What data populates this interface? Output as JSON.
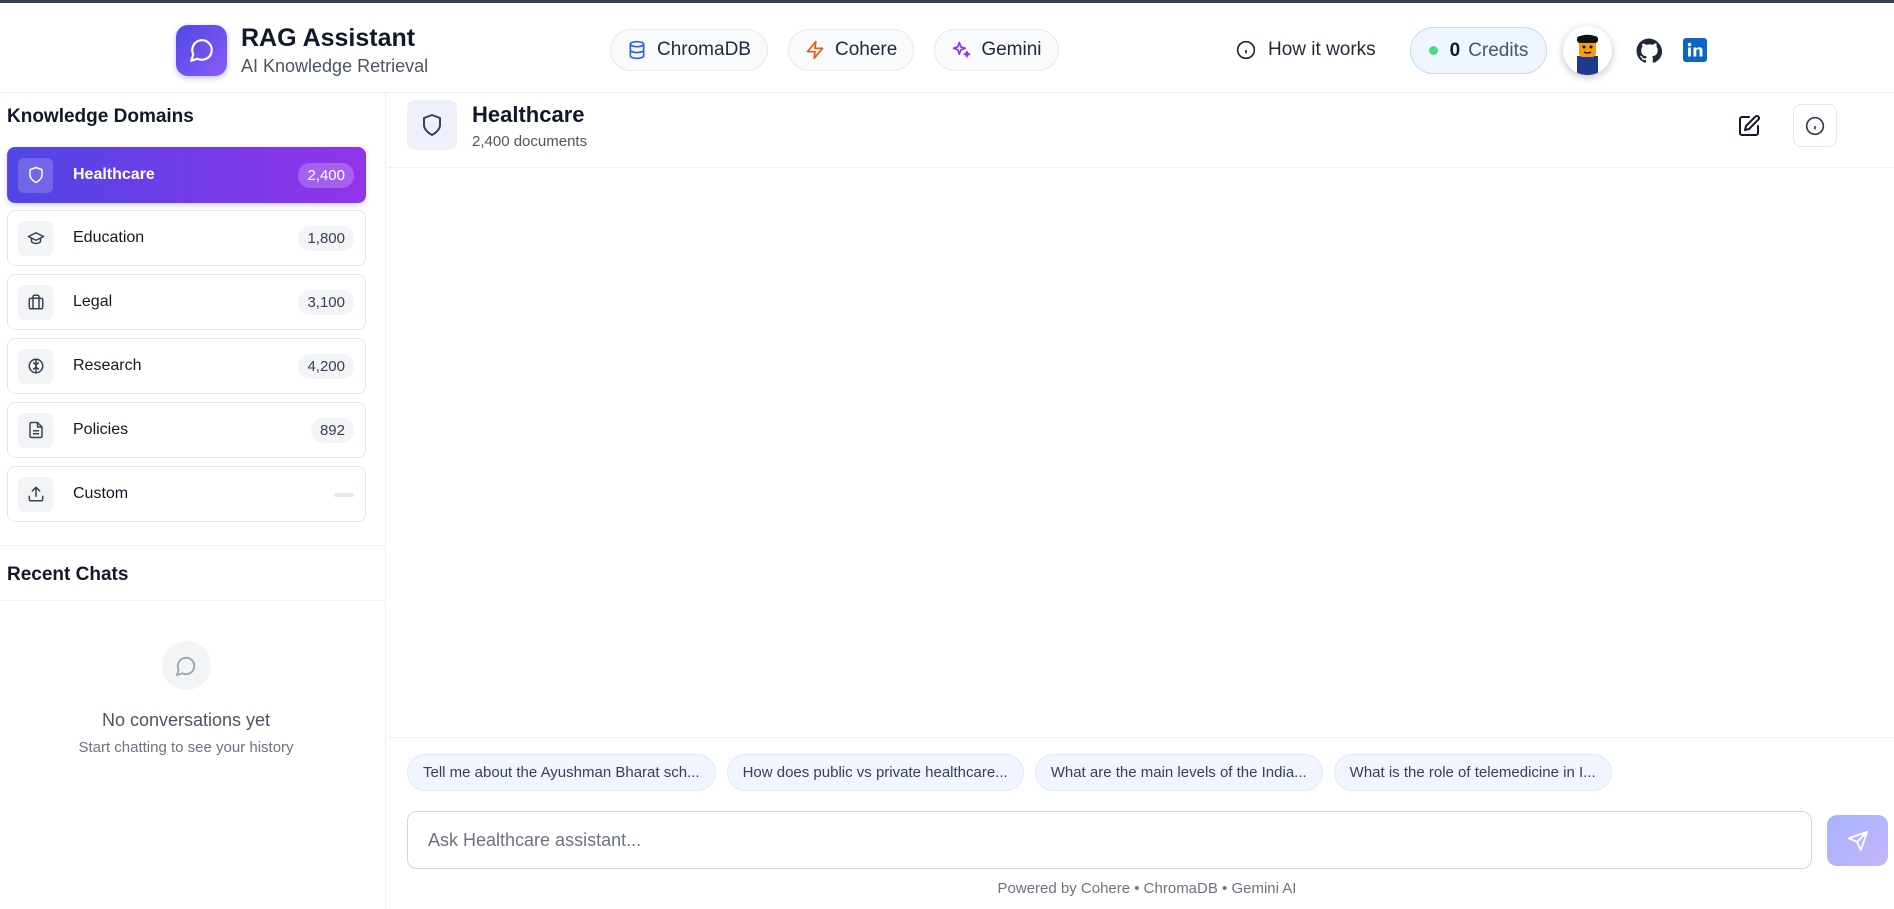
{
  "header": {
    "title": "RAG Assistant",
    "subtitle": "AI Knowledge Retrieval",
    "tech": [
      {
        "label": "ChromaDB",
        "icon": "database-icon",
        "color": "#2563eb"
      },
      {
        "label": "Cohere",
        "icon": "bolt-icon",
        "color": "#ea580c"
      },
      {
        "label": "Gemini",
        "icon": "sparkles-icon",
        "color": "#9333ea"
      }
    ],
    "how_it_works": "How it works",
    "credits_count": "0",
    "credits_label": "Credits"
  },
  "sidebar": {
    "domains_heading": "Knowledge Domains",
    "domains": [
      {
        "label": "Healthcare",
        "count": "2,400",
        "icon": "shield-icon",
        "active": true
      },
      {
        "label": "Education",
        "count": "1,800",
        "icon": "graduation-cap-icon",
        "active": false
      },
      {
        "label": "Legal",
        "count": "3,100",
        "icon": "briefcase-icon",
        "active": false
      },
      {
        "label": "Research",
        "count": "4,200",
        "icon": "brain-icon",
        "active": false
      },
      {
        "label": "Policies",
        "count": "892",
        "icon": "document-icon",
        "active": false
      },
      {
        "label": "Custom",
        "count": "",
        "icon": "upload-icon",
        "active": false
      }
    ],
    "recent_heading": "Recent Chats",
    "empty_title": "No conversations yet",
    "empty_subtitle": "Start chatting to see your history"
  },
  "main": {
    "domain_title": "Healthcare",
    "domain_docs": "2,400 documents",
    "suggestions": [
      "Tell me about the Ayushman Bharat sch...",
      "How does public vs private healthcare...",
      "What are the main levels of the India...",
      "What is the role of telemedicine in I..."
    ],
    "input_placeholder": "Ask Healthcare assistant...",
    "powered_by": "Powered by Cohere • ChromaDB • Gemini AI"
  },
  "colors": {
    "accent_start": "#4f46e5",
    "accent_end": "#9333ea",
    "linkedin": "#0a66c2"
  }
}
